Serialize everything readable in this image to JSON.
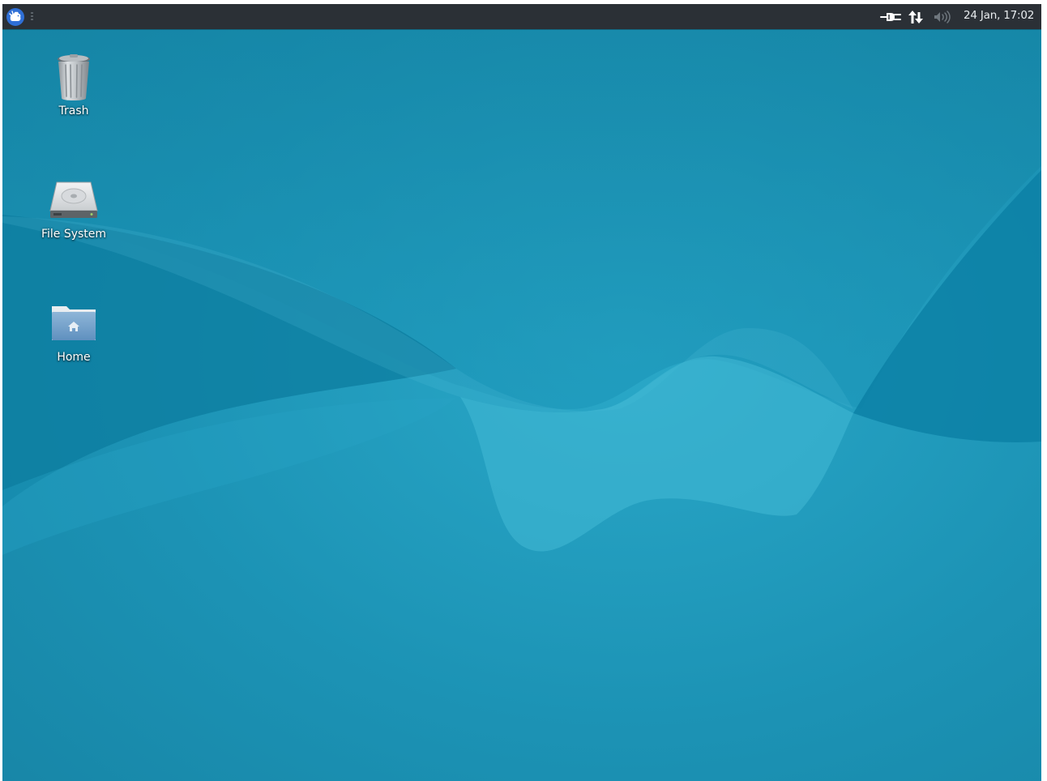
{
  "panel": {
    "menu_button_icon": "xfce-mouse-logo-icon",
    "tray": [
      {
        "name": "power-plug-icon"
      },
      {
        "name": "network-arrows-icon"
      },
      {
        "name": "volume-icon"
      }
    ],
    "clock": "24 Jan, 17:02"
  },
  "desktop": {
    "icons": [
      {
        "label": "Trash",
        "icon": "trash-icon"
      },
      {
        "label": "File System",
        "icon": "hard-drive-icon"
      },
      {
        "label": "Home",
        "icon": "home-folder-icon"
      }
    ]
  },
  "colors": {
    "panel_bg": "#2b3036",
    "wallpaper_base": "#1b8fb0",
    "wallpaper_light": "#3fb6d3",
    "wallpaper_dark": "#0f7497",
    "label_text": "#ffffff"
  }
}
